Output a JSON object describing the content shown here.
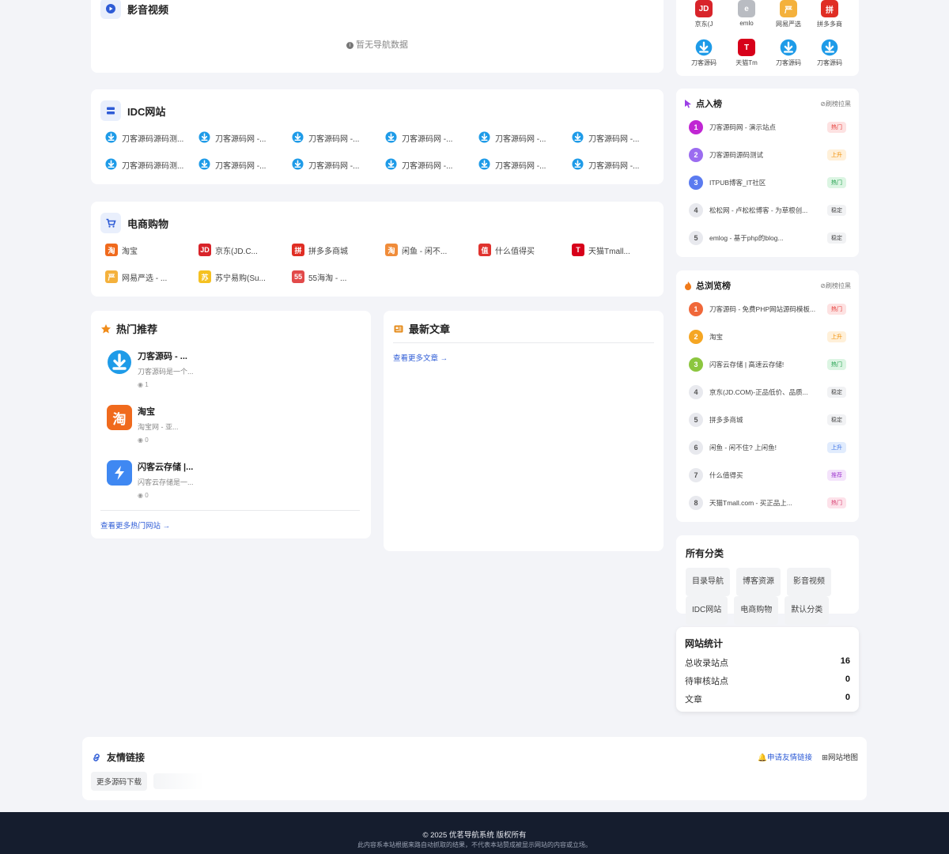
{
  "video": {
    "title": "影音视频",
    "empty": "暂无导航数据"
  },
  "idc": {
    "title": "IDC网站",
    "links": [
      "刀客源码源码测...",
      "刀客源码网 -...",
      "刀客源码网 -...",
      "刀客源码网 -...",
      "刀客源码网 -...",
      "刀客源码网 -...",
      "刀客源码源码测...",
      "刀客源码网 -...",
      "刀客源码网 -...",
      "刀客源码网 -...",
      "刀客源码网 -...",
      "刀客源码网 -..."
    ]
  },
  "shop": {
    "title": "电商购物",
    "links": [
      {
        "label": "淘宝",
        "glyph": "淘",
        "color": "#f06a1d"
      },
      {
        "label": "京东(JD.C...",
        "glyph": "JD",
        "color": "#d8242a"
      },
      {
        "label": "拼多多商城",
        "glyph": "拼",
        "color": "#e02e24"
      },
      {
        "label": "闲鱼 - 闲不...",
        "glyph": "淘",
        "color": "#f08c3a"
      },
      {
        "label": "什么值得买",
        "glyph": "值",
        "color": "#e0332f"
      },
      {
        "label": "天猫Tmall...",
        "glyph": "T",
        "color": "#d7001a"
      },
      {
        "label": "网易严选 - ...",
        "glyph": "严",
        "color": "#f4b13c"
      },
      {
        "label": "苏宁易购(Su...",
        "glyph": "苏",
        "color": "#f5c122"
      },
      {
        "label": "55海淘 - ...",
        "glyph": "55",
        "color": "#e24a4a"
      }
    ]
  },
  "hot": {
    "title": "热门推荐",
    "items": [
      {
        "name": "刀客源码 - ...",
        "desc": "刀客源码是一个...",
        "views": "1",
        "color": "#1e9be8"
      },
      {
        "name": "淘宝",
        "desc": "淘宝网 - 亚...",
        "views": "0",
        "color": "#f06a1d"
      },
      {
        "name": "闪客云存储 |...",
        "desc": "闪客云存储是一...",
        "views": "0",
        "color": "#3f88f2"
      }
    ],
    "more": "查看更多热门网站"
  },
  "articles": {
    "title": "最新文章",
    "more": "查看更多文章"
  },
  "top_apps": [
    {
      "label": "京东(J",
      "glyph": "JD",
      "color": "#d8242a"
    },
    {
      "label": "emlo",
      "glyph": "e",
      "color": "#b9bcc2"
    },
    {
      "label": "网易严选",
      "glyph": "严",
      "color": "#f4b13c"
    },
    {
      "label": "拼多多商",
      "glyph": "拼",
      "color": "#e02e24"
    },
    {
      "label": "刀客源码",
      "glyph": "dl",
      "color": "#1e9be8"
    },
    {
      "label": "天猫Tm",
      "glyph": "T",
      "color": "#d7001a"
    },
    {
      "label": "刀客源码",
      "glyph": "dl",
      "color": "#1e9be8"
    },
    {
      "label": "刀客源码",
      "glyph": "dl",
      "color": "#1e9be8"
    }
  ],
  "click_rank": {
    "title": "点入榜",
    "action": "刷榜拉黑",
    "items": [
      {
        "num": "1",
        "name": "刀客源码网 - 演示站点",
        "tag": "热门",
        "bg": "#c026d3",
        "tagbg": "#fde2e2",
        "tagfg": "#e53935"
      },
      {
        "num": "2",
        "name": "刀客源码源码测试",
        "tag": "上升",
        "bg": "#9b6cf0",
        "tagbg": "#fff0d9",
        "tagfg": "#f08c00"
      },
      {
        "num": "3",
        "name": "ITPUB博客_IT社区",
        "tag": "热门",
        "bg": "#5b7bf0",
        "tagbg": "#dcf5e3",
        "tagfg": "#1e9e4a"
      },
      {
        "num": "4",
        "name": "松松网 - 卢松松博客 - 为草根创...",
        "tag": "稳定",
        "bg": "#e8e9ee",
        "tagbg": "#f1f2f4",
        "tagfg": "#444"
      },
      {
        "num": "5",
        "name": "emlog - 基于php的blog...",
        "tag": "稳定",
        "bg": "#e8e9ee",
        "tagbg": "#f1f2f4",
        "tagfg": "#444"
      }
    ]
  },
  "view_rank": {
    "title": "总浏览榜",
    "action": "刷榜拉黑",
    "items": [
      {
        "num": "1",
        "name": "刀客源码 - 免费PHP网站源码模板...",
        "tag": "热门",
        "bg": "#f0683a",
        "tagbg": "#fde2e2",
        "tagfg": "#e53935"
      },
      {
        "num": "2",
        "name": "淘宝",
        "tag": "上升",
        "bg": "#f5a623",
        "tagbg": "#fff0d9",
        "tagfg": "#f08c00"
      },
      {
        "num": "3",
        "name": "闪客云存储 | 高速云存储!",
        "tag": "热门",
        "bg": "#8cc63f",
        "tagbg": "#dcf5e3",
        "tagfg": "#1e9e4a"
      },
      {
        "num": "4",
        "name": "京东(JD.COM)-正品低价、品质...",
        "tag": "稳定",
        "bg": "#e8e9ee",
        "tagbg": "#f1f2f4",
        "tagfg": "#444"
      },
      {
        "num": "5",
        "name": "拼多多商城",
        "tag": "稳定",
        "bg": "#e8e9ee",
        "tagbg": "#f1f2f4",
        "tagfg": "#444"
      },
      {
        "num": "6",
        "name": "闲鱼 - 闲不住? 上闲鱼!",
        "tag": "上升",
        "bg": "#e8e9ee",
        "tagbg": "#e1ecfd",
        "tagfg": "#3b72e6"
      },
      {
        "num": "7",
        "name": "什么值得买",
        "tag": "推荐",
        "bg": "#e8e9ee",
        "tagbg": "#f4e3fb",
        "tagfg": "#a23fd0"
      },
      {
        "num": "8",
        "name": "天猫Tmall.com - 买正品上...",
        "tag": "热门",
        "bg": "#e8e9ee",
        "tagbg": "#fde2ea",
        "tagfg": "#d63a6e"
      }
    ]
  },
  "categories": {
    "title": "所有分类",
    "items": [
      "目录导航",
      "博客资源",
      "影音视频",
      "IDC网站",
      "电商购物",
      "默认分类"
    ]
  },
  "stats": {
    "title": "网站统计",
    "rows": [
      {
        "label": "总收录站点",
        "value": "16"
      },
      {
        "label": "待审核站点",
        "value": "0"
      },
      {
        "label": "文章",
        "value": "0"
      }
    ]
  },
  "friends": {
    "title": "友情链接",
    "apply": "申请友情链接",
    "sitemap": "网站地图",
    "links": [
      "更多源码下载"
    ]
  },
  "footer": {
    "copyright": "© 2025 优茗导航系统 版权所有",
    "disclaimer": "此内容系本站根据来路自动抓取的结果，不代表本站赞成被显示网站的内容或立场。"
  }
}
